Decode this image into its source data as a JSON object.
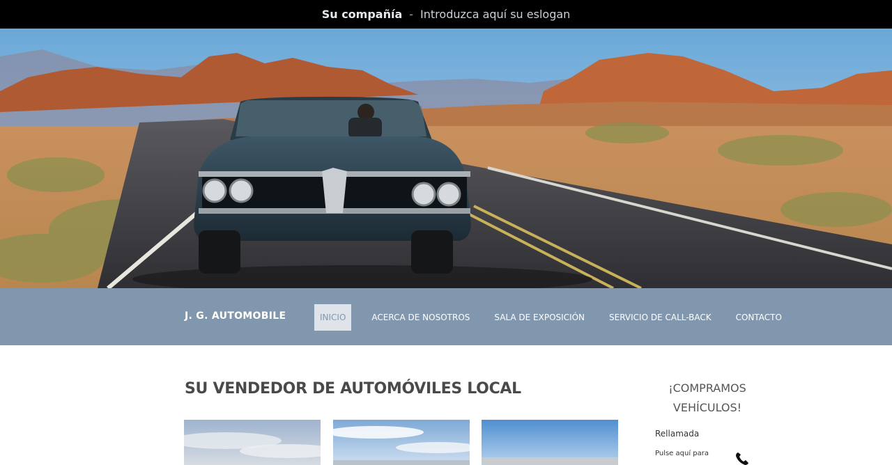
{
  "header": {
    "company": "Su compañía",
    "separator": "-",
    "slogan": "Introduzca aquí su eslogan"
  },
  "hero": {
    "image": "convertible-car-desert-road"
  },
  "nav": {
    "brand": "J. G. AUTOMOBILE",
    "items": [
      {
        "label": "INICIO",
        "active": true
      },
      {
        "label": "ACERCA DE NOSOTROS",
        "active": false
      },
      {
        "label": "SALA DE EXPOSICIÓN",
        "active": false
      },
      {
        "label": "SERVICIO DE CALL-BACK",
        "active": false
      },
      {
        "label": "CONTACTO",
        "active": false
      }
    ]
  },
  "main": {
    "title": "SU VENDEDOR DE AUTOMÓVILES LOCAL",
    "thumbnails": [
      "sky-landscape-1",
      "sky-landscape-2",
      "sky-landscape-3"
    ]
  },
  "sidebar": {
    "title_line1": "¡COMPRAMOS",
    "title_line2": "VEHÍCULOS!",
    "callback_label": "Rellamada",
    "callback_text": "Pulse aquí para",
    "icon": "phone-icon"
  },
  "colors": {
    "topbar": "#000000",
    "nav": "#8197ae",
    "active_item_bg": "#dfe4ea"
  }
}
